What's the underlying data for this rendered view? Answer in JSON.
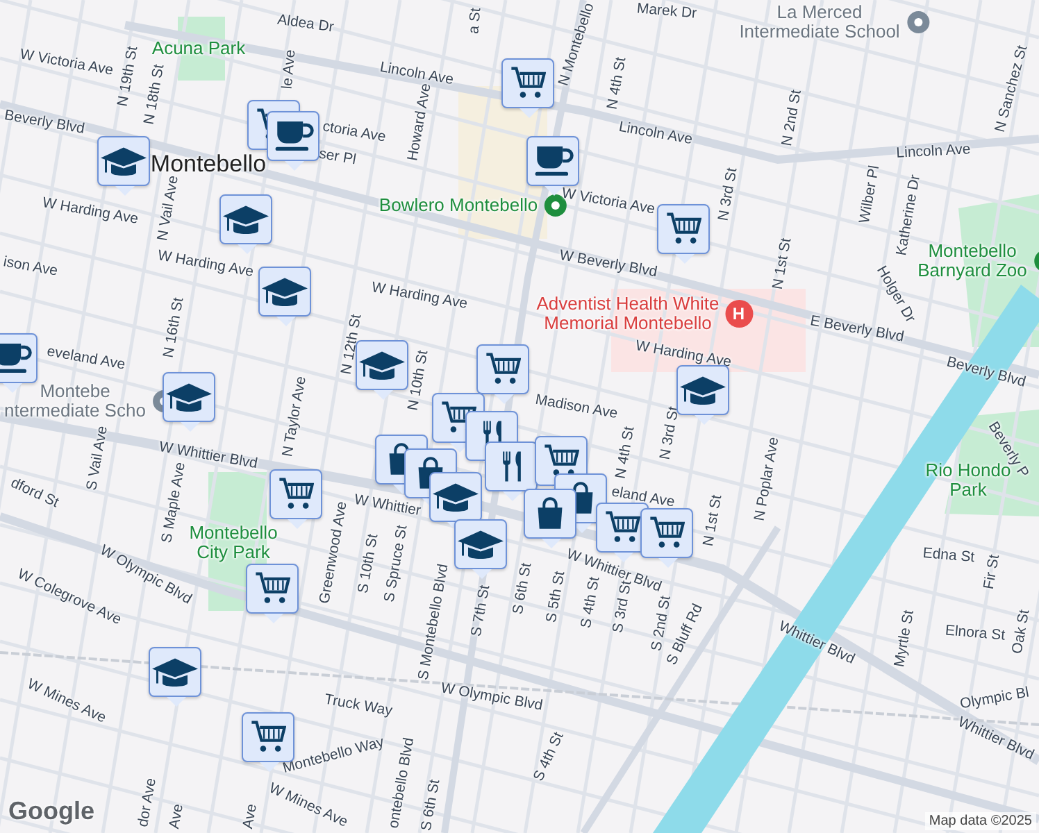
{
  "map": {
    "labels": [
      {
        "kind": "street",
        "lines": [
          "Aldea Dr"
        ]
      },
      {
        "kind": "street",
        "lines": [
          "W Victoria Ave"
        ]
      },
      {
        "kind": "street",
        "lines": [
          "N 19th St"
        ]
      },
      {
        "kind": "park",
        "lines": [
          "Acuna Park"
        ]
      },
      {
        "kind": "street",
        "lines": [
          "N 18th St"
        ]
      },
      {
        "kind": "street",
        "lines": [
          "Lincoln Ave"
        ]
      },
      {
        "kind": "street",
        "lines": [
          "Lincoln Ave"
        ]
      },
      {
        "kind": "street",
        "lines": [
          "Lincoln Ave"
        ]
      },
      {
        "kind": "street",
        "lines": [
          "le Ave"
        ]
      },
      {
        "kind": "street",
        "lines": [
          "Beverly Blvd"
        ]
      },
      {
        "kind": "street",
        "lines": [
          "ctoria Ave"
        ]
      },
      {
        "kind": "street",
        "lines": [
          "ser Pl"
        ]
      },
      {
        "kind": "city",
        "lines": [
          "Montebello"
        ]
      },
      {
        "kind": "street",
        "lines": [
          "Howard Ave"
        ]
      },
      {
        "kind": "place",
        "lines": [
          "Bowlero Montebello"
        ]
      },
      {
        "kind": "street",
        "lines": [
          "W Harding Ave"
        ]
      },
      {
        "kind": "street",
        "lines": [
          "N Vail Ave"
        ]
      },
      {
        "kind": "street",
        "lines": [
          "W Harding Ave"
        ]
      },
      {
        "kind": "street",
        "lines": [
          "W Harding Ave"
        ]
      },
      {
        "kind": "street",
        "lines": [
          "N 12th St"
        ]
      },
      {
        "kind": "street",
        "lines": [
          "ison Ave"
        ]
      },
      {
        "kind": "street",
        "lines": [
          "eveland Ave"
        ]
      },
      {
        "kind": "street",
        "lines": [
          "N 16th St"
        ]
      },
      {
        "kind": "school",
        "lines": [
          "Montebe",
          "ntermediate Scho"
        ]
      },
      {
        "kind": "street",
        "lines": [
          "N Taylor Ave"
        ]
      },
      {
        "kind": "street",
        "lines": [
          "N 10th St"
        ]
      },
      {
        "kind": "hospital",
        "lines": [
          "Adventist Health White",
          "Memorial Montebello"
        ],
        "pin_text": "H"
      },
      {
        "kind": "street",
        "lines": [
          "W Beverly Blvd"
        ]
      },
      {
        "kind": "street",
        "lines": [
          "E Beverly Blvd"
        ]
      },
      {
        "kind": "street",
        "lines": [
          "Beverly Blvd"
        ]
      },
      {
        "kind": "street",
        "lines": [
          "W Harding Ave"
        ]
      },
      {
        "kind": "street",
        "lines": [
          "Madison Ave"
        ]
      },
      {
        "kind": "street",
        "lines": [
          "N 4th St"
        ]
      },
      {
        "kind": "street",
        "lines": [
          "N 2nd St"
        ]
      },
      {
        "kind": "street",
        "lines": [
          "N 3rd St"
        ]
      },
      {
        "kind": "street",
        "lines": [
          "W Victoria Ave"
        ]
      },
      {
        "kind": "street",
        "lines": [
          "N 1st St"
        ]
      },
      {
        "kind": "street",
        "lines": [
          "Wilber Pl"
        ]
      },
      {
        "kind": "street",
        "lines": [
          "Katherine Dr"
        ]
      },
      {
        "kind": "street",
        "lines": [
          "Holger Dr"
        ]
      },
      {
        "kind": "place",
        "lines": [
          "Montebello",
          "Barnyard Zoo"
        ]
      },
      {
        "kind": "street",
        "lines": [
          "N Sanchez St"
        ]
      },
      {
        "kind": "school",
        "lines": [
          "La Merced",
          "Intermediate School"
        ]
      },
      {
        "kind": "street",
        "lines": [
          "Marek Dr"
        ]
      },
      {
        "kind": "street",
        "lines": [
          "N Montebello"
        ]
      },
      {
        "kind": "street",
        "lines": [
          "a St"
        ]
      },
      {
        "kind": "street",
        "lines": [
          "N 4th St"
        ]
      },
      {
        "kind": "street",
        "lines": [
          "N 3rd St"
        ]
      },
      {
        "kind": "street",
        "lines": [
          "N 1st St"
        ]
      },
      {
        "kind": "street",
        "lines": [
          "N Poplar Ave"
        ]
      },
      {
        "kind": "park",
        "lines": [
          "Rio Hondo",
          "Park"
        ]
      },
      {
        "kind": "street",
        "lines": [
          "Beverly P"
        ]
      },
      {
        "kind": "street",
        "lines": [
          "Edna St"
        ]
      },
      {
        "kind": "street",
        "lines": [
          "Fir St"
        ]
      },
      {
        "kind": "street",
        "lines": [
          "Elnora St"
        ]
      },
      {
        "kind": "street",
        "lines": [
          "Oak St"
        ]
      },
      {
        "kind": "street",
        "lines": [
          "Myrtle St"
        ]
      },
      {
        "kind": "street",
        "lines": [
          "Whittier Blvd"
        ]
      },
      {
        "kind": "street",
        "lines": [
          "Olympic Bl"
        ]
      },
      {
        "kind": "street",
        "lines": [
          "Whittier Blvd"
        ]
      },
      {
        "kind": "street",
        "lines": [
          "S Bluff Rd"
        ]
      },
      {
        "kind": "street",
        "lines": [
          "S 2nd St"
        ]
      },
      {
        "kind": "street",
        "lines": [
          "S 3rd St"
        ]
      },
      {
        "kind": "street",
        "lines": [
          "S 4th St"
        ]
      },
      {
        "kind": "street",
        "lines": [
          "S 5th St"
        ]
      },
      {
        "kind": "street",
        "lines": [
          "S 6th St"
        ]
      },
      {
        "kind": "street",
        "lines": [
          "S 4th St"
        ]
      },
      {
        "kind": "street",
        "lines": [
          "W Whittier Blvd"
        ]
      },
      {
        "kind": "street",
        "lines": [
          "eland Ave"
        ]
      },
      {
        "kind": "street",
        "lines": [
          "W Whittier Blvd"
        ]
      },
      {
        "kind": "street",
        "lines": [
          "W Whittier"
        ]
      },
      {
        "kind": "street",
        "lines": [
          "S Vail Ave"
        ]
      },
      {
        "kind": "street",
        "lines": [
          "S Maple Ave"
        ]
      },
      {
        "kind": "street",
        "lines": [
          "dford St"
        ]
      },
      {
        "kind": "park",
        "lines": [
          "Montebello",
          "City Park"
        ]
      },
      {
        "kind": "street",
        "lines": [
          "W Olympic Blvd"
        ]
      },
      {
        "kind": "street",
        "lines": [
          "W Colegrove Ave"
        ]
      },
      {
        "kind": "street",
        "lines": [
          "Greenwood Ave"
        ]
      },
      {
        "kind": "street",
        "lines": [
          "S 10th St"
        ]
      },
      {
        "kind": "street",
        "lines": [
          "S Spruce St"
        ]
      },
      {
        "kind": "street",
        "lines": [
          "S Montebello Blvd"
        ]
      },
      {
        "kind": "street",
        "lines": [
          "S 7th St"
        ]
      },
      {
        "kind": "street",
        "lines": [
          "W Olympic Blvd"
        ]
      },
      {
        "kind": "street",
        "lines": [
          "W Mines Ave"
        ]
      },
      {
        "kind": "street",
        "lines": [
          "Truck Way"
        ]
      },
      {
        "kind": "street",
        "lines": [
          "Montebello Way"
        ]
      },
      {
        "kind": "street",
        "lines": [
          "ontebello Blvd"
        ]
      },
      {
        "kind": "street",
        "lines": [
          "S 6th St"
        ]
      },
      {
        "kind": "street",
        "lines": [
          "W Mines Ave"
        ]
      },
      {
        "kind": "street",
        "lines": [
          "dor Ave"
        ]
      },
      {
        "kind": "street",
        "lines": [
          "Ave"
        ]
      },
      {
        "kind": "street",
        "lines": [
          "Ave"
        ]
      }
    ],
    "markers": [
      {
        "kind": "cart"
      },
      {
        "kind": "cart"
      },
      {
        "kind": "coffee"
      },
      {
        "kind": "school"
      },
      {
        "kind": "coffee"
      },
      {
        "kind": "school"
      },
      {
        "kind": "cart"
      },
      {
        "kind": "school"
      },
      {
        "kind": "coffee"
      },
      {
        "kind": "school"
      },
      {
        "kind": "cart"
      },
      {
        "kind": "school"
      },
      {
        "kind": "school"
      },
      {
        "kind": "cart"
      },
      {
        "kind": "cart"
      },
      {
        "kind": "school"
      },
      {
        "kind": "cart"
      },
      {
        "kind": "cart"
      },
      {
        "kind": "food"
      },
      {
        "kind": "bag"
      },
      {
        "kind": "food"
      },
      {
        "kind": "bag"
      },
      {
        "kind": "cart"
      },
      {
        "kind": "bag"
      },
      {
        "kind": "school"
      },
      {
        "kind": "bag"
      },
      {
        "kind": "cart"
      },
      {
        "kind": "cart"
      },
      {
        "kind": "school"
      }
    ]
  },
  "attribution": {
    "logo": "Google",
    "text": "Map data ©2025"
  }
}
